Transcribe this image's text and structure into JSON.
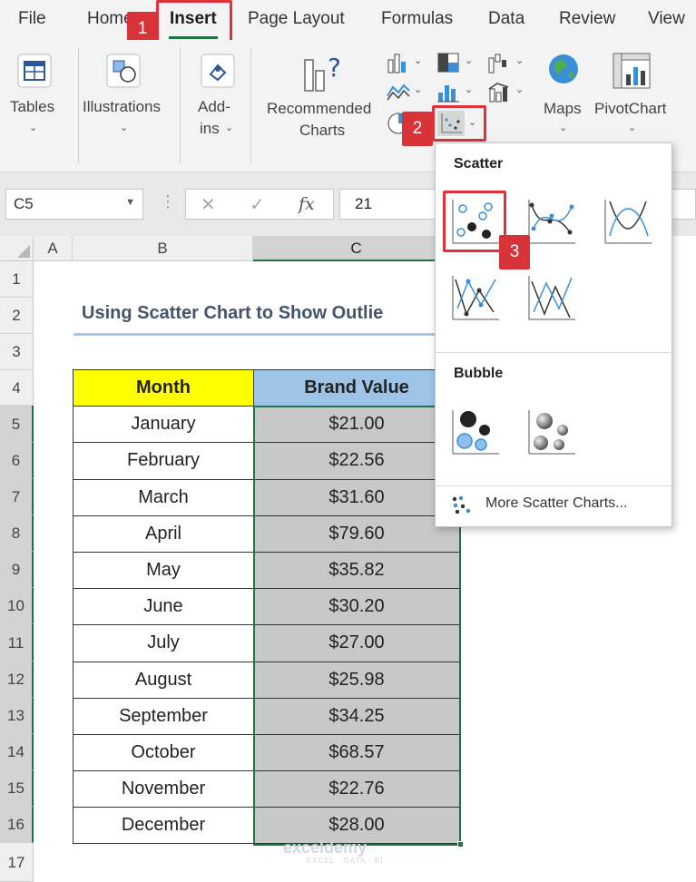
{
  "ribbon_tabs": [
    "File",
    "Home",
    "Insert",
    "Page Layout",
    "Formulas",
    "Data",
    "Review",
    "View"
  ],
  "steps": [
    "1",
    "2",
    "3"
  ],
  "groups": {
    "tables": "Tables",
    "illustrations": "Illustrations",
    "addins_line1": "Add-",
    "addins_line2": "ins",
    "recommended_line1": "Recommended",
    "recommended_line2": "Charts",
    "maps": "Maps",
    "pivotchart": "PivotChart"
  },
  "formula_bar": {
    "name_box": "C5",
    "fx": "fx",
    "value": "21"
  },
  "columns": [
    "A",
    "B",
    "C"
  ],
  "rows": [
    "1",
    "2",
    "3",
    "4",
    "5",
    "6",
    "7",
    "8",
    "9",
    "10",
    "11",
    "12",
    "13",
    "14",
    "15",
    "16",
    "17"
  ],
  "sheet": {
    "title": "Using Scatter Chart to Show Outlie",
    "headers": {
      "month": "Month",
      "value": "Brand Value"
    },
    "data": [
      {
        "month": "January",
        "value": "$21.00"
      },
      {
        "month": "February",
        "value": "$22.56"
      },
      {
        "month": "March",
        "value": "$31.60"
      },
      {
        "month": "April",
        "value": "$79.60"
      },
      {
        "month": "May",
        "value": "$35.82"
      },
      {
        "month": "June",
        "value": "$30.20"
      },
      {
        "month": "July",
        "value": "$27.00"
      },
      {
        "month": "August",
        "value": "$25.98"
      },
      {
        "month": "September",
        "value": "$34.25"
      },
      {
        "month": "October",
        "value": "$68.57"
      },
      {
        "month": "November",
        "value": "$22.76"
      },
      {
        "month": "December",
        "value": "$28.00"
      }
    ]
  },
  "dropdown": {
    "scatter_heading": "Scatter",
    "bubble_heading": "Bubble",
    "more": "More Scatter Charts..."
  },
  "watermark": {
    "name": "exceldemy",
    "tagline": "EXCEL · DATA · BI"
  },
  "colors": {
    "excel_green": "#217346",
    "highlight_red": "#e0323a",
    "header_yellow": "#ffff00",
    "header_blue": "#9dc3e6",
    "chart_blue": "#3a8fd6"
  }
}
